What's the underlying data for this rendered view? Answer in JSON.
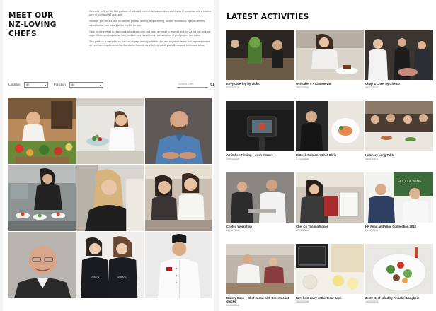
{
  "left": {
    "title_lines": [
      "MEET OUR",
      "NZ-LOVING",
      "CHEFS"
    ],
    "intro": [
      "Welcome to Chef Co! Our platform of talented chefs of all shapes sizes and levels of expertise with a shared love of food and NZ products!",
      "Whether you need a chef for demos, product testing, recipe filming, advice, exhibitions, special dinners, menu builds – we have just the right fit for you.",
      "Click on the profiles to read more about each chef and send an email to request an intro via the link on each page. When you request an intro, include your brand name, a description of your project and dates.",
      "This platform is designed so you can engage directly with the chef and negotiate terms and payment based on your own requirements but the chefco team is there to help guide you with scopes, briefs and ideas."
    ],
    "filters": {
      "location_label": "Location",
      "location_value": "all",
      "function_label": "Function",
      "function_value": "all",
      "search_placeholder": "Search Chef"
    }
  },
  "chefs": [
    {
      "id": "chef-1",
      "bg": "#b98a5c"
    },
    {
      "id": "chef-2",
      "bg": "#e8e6e1"
    },
    {
      "id": "chef-3",
      "bg": "#5e5956"
    },
    {
      "id": "chef-4",
      "bg": "#8d9393"
    },
    {
      "id": "chef-5",
      "bg": "#d8d4cf"
    },
    {
      "id": "chef-6",
      "bg": "#cbbfb1"
    },
    {
      "id": "chef-7",
      "bg": "#b7b4b0"
    },
    {
      "id": "chef-8",
      "bg": "#efeeec"
    },
    {
      "id": "chef-9",
      "bg": "#eaeaea"
    }
  ],
  "right": {
    "title": "LATEST ACTIVITIES",
    "activities": [
      {
        "title": "Envy Catering by Violet",
        "date": "07/03/2019"
      },
      {
        "title": "Whittaker's × Kim Melvin",
        "date": "28/01/2019"
      },
      {
        "title": "Chop & Chew by Chefco",
        "date": "28/07/2019"
      },
      {
        "title": "A Kitchen Filming – Josh Emmet",
        "date": "19/01/2019"
      },
      {
        "title": "MiCook Salmon × Chef Chris",
        "date": "27/12/2018"
      },
      {
        "title": "Hatchery Long Table",
        "date": "08/11/2018"
      },
      {
        "title": "Chefco Workshop",
        "date": "08/11/2018"
      },
      {
        "title": "Chef Co Tooling Boxes",
        "date": "27/08/2018"
      },
      {
        "title": "HK Food and Wine Connection 2018",
        "date": "25/07/2018"
      },
      {
        "title": "Bakery Expo – Chef Jason with Greenmount stocks",
        "date": "10/05/2018"
      },
      {
        "title": "NZ's best dairy at the Treat Sach",
        "date": "26/04/2018"
      },
      {
        "title": "Zesty Beef salad by Annabel Langbein",
        "date": "14/03/2018"
      }
    ]
  }
}
